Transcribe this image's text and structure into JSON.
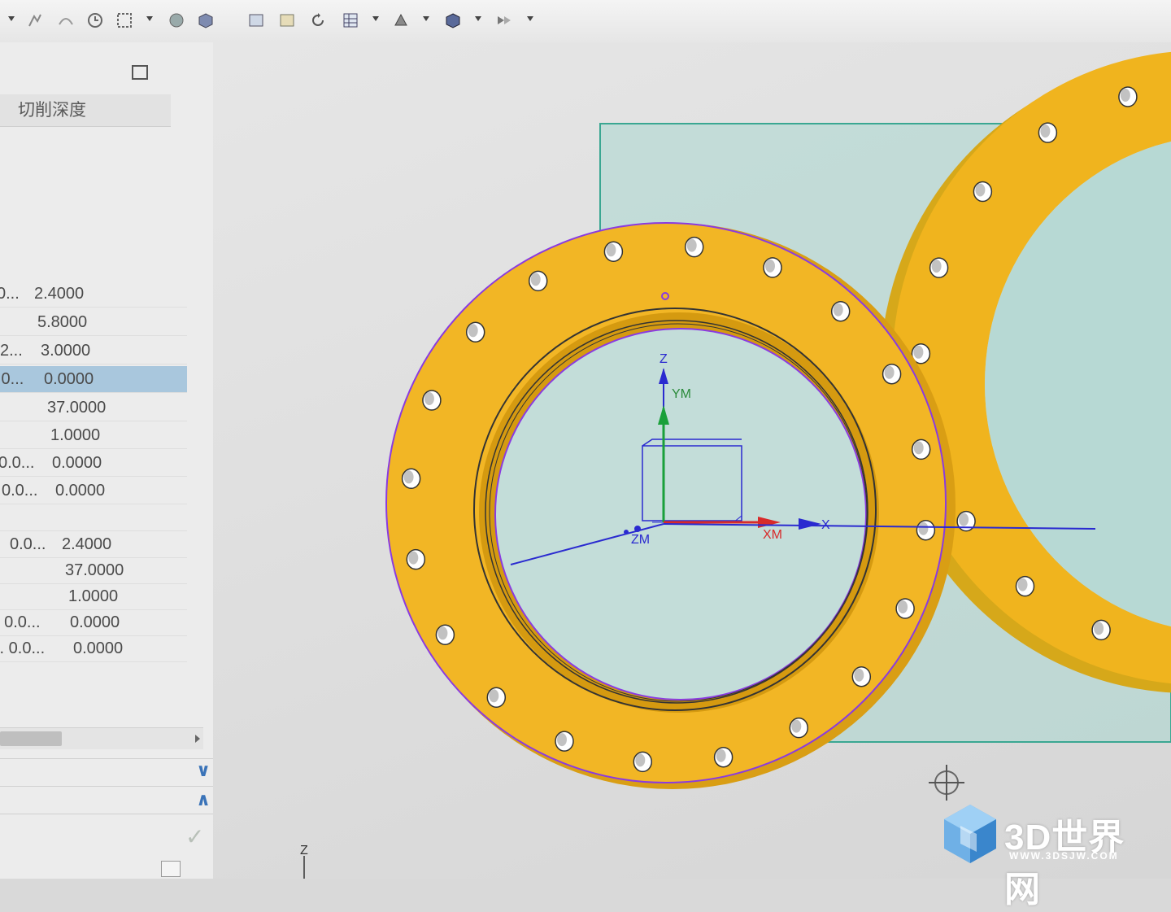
{
  "panel": {
    "column_header": "切削深度",
    "rows": [
      {
        "c1": "0...",
        "c2": "2.4000",
        "selected": false
      },
      {
        "c1": "",
        "c2": "5.8000",
        "selected": false
      },
      {
        "c1": "2...",
        "c2": "3.0000",
        "selected": false
      },
      {
        "c1": ".0...",
        "c2": "0.0000",
        "selected": true
      },
      {
        "c1": "",
        "c2": "37.0000",
        "selected": false
      },
      {
        "c1": "",
        "c2": "1.0000",
        "selected": false
      },
      {
        "c1": "0.0...",
        "c2": "0.0000",
        "selected": false
      },
      {
        "c1": "0.0...",
        "c2": "0.0000",
        "selected": false
      },
      {
        "c1": "",
        "c2": "",
        "selected": false
      },
      {
        "c1": "0.0...",
        "c2": "2.4000",
        "selected": false
      },
      {
        "c1": "",
        "c2": "37.0000",
        "selected": false
      },
      {
        "c1": "",
        "c2": "1.0000",
        "selected": false
      },
      {
        "c1": ". 0.0...",
        "c2": "0.0000",
        "selected": false
      },
      {
        "c1": ".. 0.0...",
        "c2": "0.0000",
        "selected": false
      }
    ],
    "expand_label": "∨",
    "collapse_label": "∧",
    "ok_label": "✓"
  },
  "toolbar": {
    "icons": [
      "dropdown-icon",
      "snap-icon",
      "curve-icon",
      "clock-icon",
      "select-box-icon",
      "sphere-icon",
      "cube-icon",
      "view-frame-icon",
      "view-image-icon",
      "rotate-icon",
      "table-icon",
      "render-icon",
      "shaded-cube-icon",
      "arrow-sets-icon"
    ]
  },
  "viewport": {
    "axis_z": "Z",
    "axis_ym": "YM",
    "axis_zm": "ZM",
    "axis_xm": "XM",
    "axis_x": "X",
    "bottom_axis_z": "Z",
    "colors": {
      "flange": "#f0b41e",
      "flange_dark": "#d9a316",
      "plane": "#a9d7d0",
      "plane_edge": "#3aa792",
      "outline": "#8a3be0",
      "axis_blue": "#2a2ad0",
      "axis_green": "#1aa03a",
      "axis_red": "#d82a2a"
    }
  },
  "watermark": {
    "brand": "3D世界网",
    "url": "WWW.3DSJW.COM"
  }
}
